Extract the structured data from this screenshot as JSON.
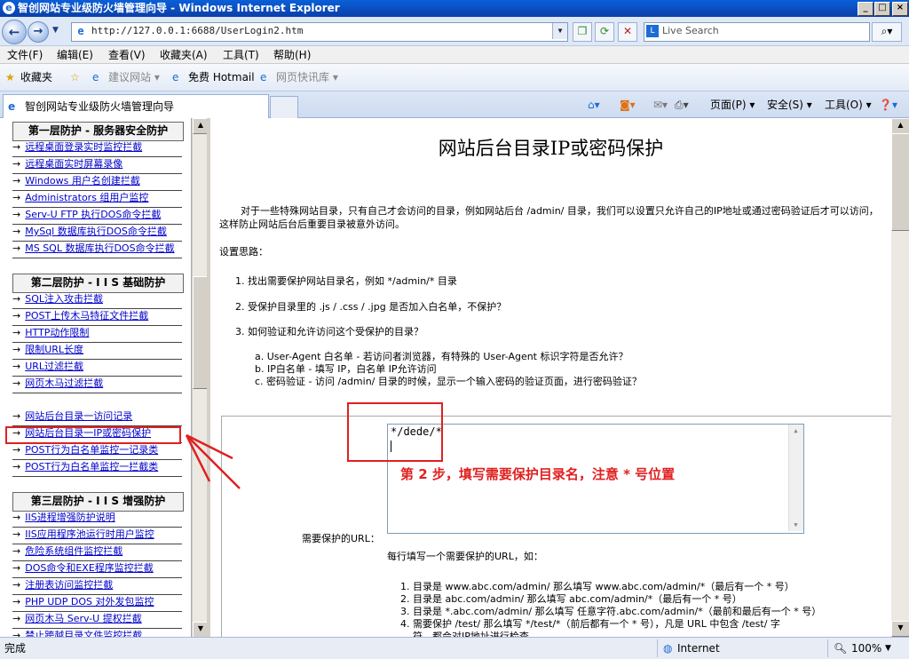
{
  "window": {
    "title": "智创网站专业级防火墙管理向导 - Windows Internet Explorer",
    "controls": [
      "_",
      "□",
      "×"
    ]
  },
  "nav": {
    "address": "http://127.0.0.1:6688/UserLogin2.htm",
    "search_placeholder": "Live Search"
  },
  "menu": [
    "文件(F)",
    "编辑(E)",
    "查看(V)",
    "收藏夹(A)",
    "工具(T)",
    "帮助(H)"
  ],
  "favorites": {
    "label": "收藏夹",
    "items": [
      "建议网站 ▾",
      "免费 Hotmail",
      "网页快讯库 ▾"
    ]
  },
  "tab": {
    "title": "智创网站专业级防火墙管理向导",
    "tools": [
      "页面(P) ▾",
      "安全(S) ▾",
      "工具(O) ▾"
    ]
  },
  "sidebar": {
    "sections": [
      {
        "title": "第一层防护 - 服务器安全防护",
        "items": [
          "远程桌面登录实时监控拦截",
          "远程桌面实时屏幕录像",
          "Windows 用户名创建拦截",
          "Administrators 组用户监控",
          "Serv-U FTP 执行DOS命令拦截",
          "MySql 数据库执行DOS命令拦截",
          "MS SQL 数据库执行DOS命令拦截"
        ]
      },
      {
        "title": "第二层防护 - I I S 基础防护",
        "items": [
          "SQL注入攻击拦截",
          "POST上传木马特征文件拦截",
          "HTTP动作限制",
          "限制URL长度",
          "URL过滤拦截",
          "网页木马过滤拦截"
        ]
      },
      {
        "title": "",
        "items": [
          "网站后台目录一访问记录",
          "网站后台目录一IP或密码保护",
          "POST行为白名单监控一记录类",
          "POST行为白名单监控一拦截类"
        ]
      },
      {
        "title": "第三层防护 - I I S 增强防护",
        "items": [
          "IIS进程增强防护说明",
          "IIS应用程序池运行时用户监控",
          "危险系统组件监控拦截",
          "DOS命令和EXE程序监控拦截",
          "注册表访问监控拦截",
          "PHP UDP DOS 对外发包监控",
          "网页木马 Serv-U 提权拦截",
          "禁止跨越目录文件监控拦截"
        ]
      }
    ]
  },
  "content": {
    "title": "网站后台目录IP或密码保护",
    "intro": "对于一些特殊网站目录，只有自己才会访问的目录，例如网站后台 /admin/ 目录，我们可以设置只允许自己的IP地址或通过密码验证后才可以访问，这样防止网站后台后重要目录被意外访问。",
    "ideas_label": "设置思路：",
    "steps": [
      "1.  找出需要保护网站目录名，例如 */admin/* 目录",
      "2.  受保护目录里的 .js / .css / .jpg 是否加入白名单，不保护？",
      "3.  如何验证和允许访问这个受保护的目录？"
    ],
    "substeps": [
      "a. User-Agent 白名单 - 若访问者浏览器，有特殊的 User-Agent 标识字符是否允许？",
      "b. IP白名单 - 填写 IP，白名单 IP允许访问",
      "c. 密码验证 - 访问 /admin/ 目录的时候，显示一个输入密码的验证页面，进行密码验证？"
    ],
    "form": {
      "url_label": "需要保护的URL：",
      "url_value": "*/dede/*",
      "hint": "每行填写一个需要保护的URL，如：",
      "examples": [
        "1.  目录是 www.abc.com/admin/ 那么填写 www.abc.com/admin/*（最后有一个 * 号）",
        "2.  目录是  abc.com/admin/ 那么填写  abc.com/admin/*（最后有一个 * 号）",
        "3.  目录是 *.abc.com/admin/ 那么填写 任意字符.abc.com/admin/*（最前和最后有一个 * 号）",
        "4.  需要保护 /test/ 那么填写 */test/*（前后都有一个 * 号），凡是 URL 中包含 /test/ 字",
        "    符，都会对IP地址进行检查"
      ]
    },
    "annotation": "第 2 步，填写需要保护目录名，注意 * 号位置"
  },
  "status": {
    "left": "完成",
    "zone": "Internet",
    "zoom": "100%"
  },
  "colors": {
    "annotation": "#e02020",
    "link": "#0000cc"
  }
}
